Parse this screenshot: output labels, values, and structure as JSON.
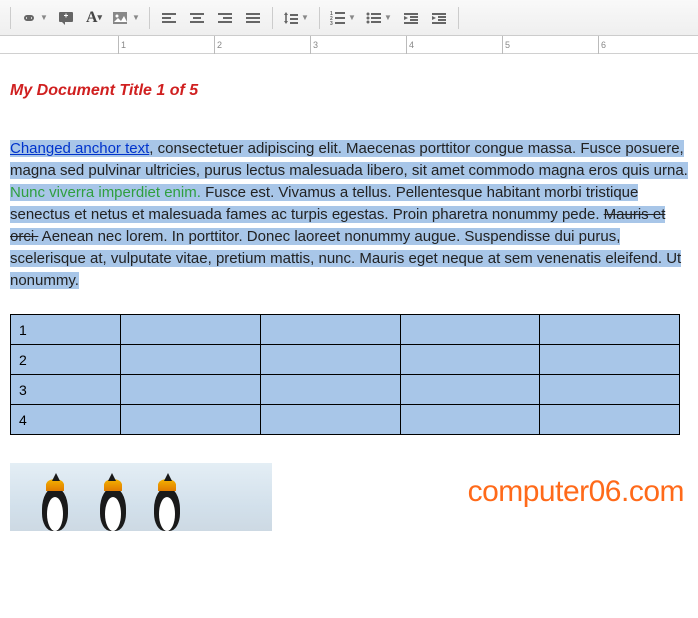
{
  "ruler": {
    "labels": [
      1,
      2,
      3,
      4,
      5,
      6
    ]
  },
  "document": {
    "title": "My Document Title 1 of 5",
    "anchor_text": "Changed anchor text",
    "text_after_anchor": ", consectetuer adipiscing elit. Maecenas porttitor congue massa. Fusce posuere, magna sed pulvinar ultricies, purus lectus malesuada libero, sit amet commodo magna eros quis urna. ",
    "green_text": "Nunc viverra imperdiet enim.",
    "text_after_green": " Fusce est. Vivamus a tellus. Pellentesque habitant morbi tristique senectus et netus et malesuada fames ac turpis egestas. Proin pharetra nonummy pede. ",
    "struck_text": "Mauris et orci.",
    "text_after_struck": " Aenean nec lorem. In porttitor. Donec laoreet nonummy augue. Suspendisse dui purus, scelerisque at, vulputate vitae, pretium mattis, nunc. Mauris eget neque at sem venenatis eleifend. Ut nonummy."
  },
  "table": {
    "rows": [
      {
        "num": "1",
        "cells": [
          "",
          "",
          "",
          ""
        ]
      },
      {
        "num": "2",
        "cells": [
          "",
          "",
          "",
          ""
        ]
      },
      {
        "num": "3",
        "cells": [
          "",
          "",
          "",
          ""
        ]
      },
      {
        "num": "4",
        "cells": [
          "",
          "",
          "",
          ""
        ]
      }
    ]
  },
  "watermark": "computer06.com"
}
